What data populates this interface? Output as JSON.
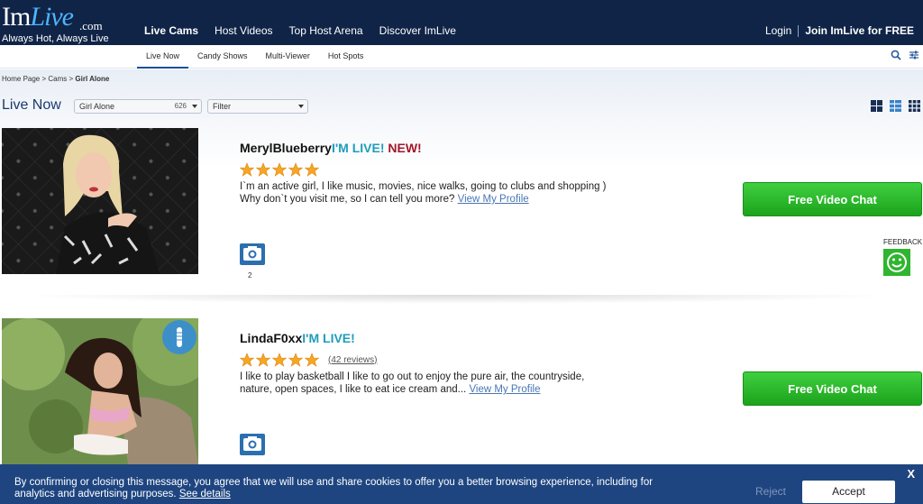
{
  "logo": {
    "brand_im": "Im",
    "brand_live": "Live",
    "dotcom": ".com",
    "tagline": "Always Hot, Always Live"
  },
  "nav": {
    "items": [
      {
        "label": "Live Cams",
        "active": true
      },
      {
        "label": "Host Videos"
      },
      {
        "label": "Top Host Arena"
      },
      {
        "label": "Discover ImLive"
      }
    ],
    "login": "Login",
    "join": "Join ImLive for FREE"
  },
  "subnav": {
    "items": [
      {
        "label": "Live Now",
        "active": true
      },
      {
        "label": "Candy Shows"
      },
      {
        "label": "Multi-Viewer"
      },
      {
        "label": "Hot Spots"
      }
    ]
  },
  "breadcrumb": {
    "home": "Home Page",
    "sep": ">",
    "cams": "Cams",
    "current": "Girl Alone"
  },
  "toolbar": {
    "title": "Live Now",
    "category": {
      "value": "Girl Alone",
      "count": "626"
    },
    "filter": {
      "value": "Filter"
    }
  },
  "hosts": [
    {
      "name": "MerylBlueberry",
      "live": "I'M LIVE!",
      "new": "NEW!",
      "rating": 5,
      "description": "I`m an active girl, I like music, movies, nice walks, going to clubs and shopping ) Why don`t you visit me, so I can tell you more?",
      "view_profile": "View My Profile",
      "photos": "2",
      "cta": "Free Video Chat"
    },
    {
      "name": "LindaF0xx",
      "live": "I'M LIVE!",
      "rating": 5,
      "reviews": "(42 reviews)",
      "description": "I like to play basketball I like to go out to enjoy the pure air, the countryside, nature, open spaces, I like to eat ice cream and...",
      "view_profile": "View My Profile",
      "cta": "Free Video Chat"
    }
  ],
  "feedback": {
    "label": "FEEDBACK"
  },
  "cookie": {
    "message": "By confirming or closing this message, you agree that we will use and share cookies to offer you a better browsing experience, including for analytics and advertising purposes.",
    "details": "See details",
    "reject": "Reject",
    "accept": "Accept",
    "close": "X"
  },
  "colors": {
    "topbar": "#0f2447",
    "accent_live": "#1e9dbb",
    "accent_new": "#a1182a",
    "cta_green": "#2fb52f",
    "star": "#f5a623",
    "cookie_bar": "#1e4580"
  }
}
